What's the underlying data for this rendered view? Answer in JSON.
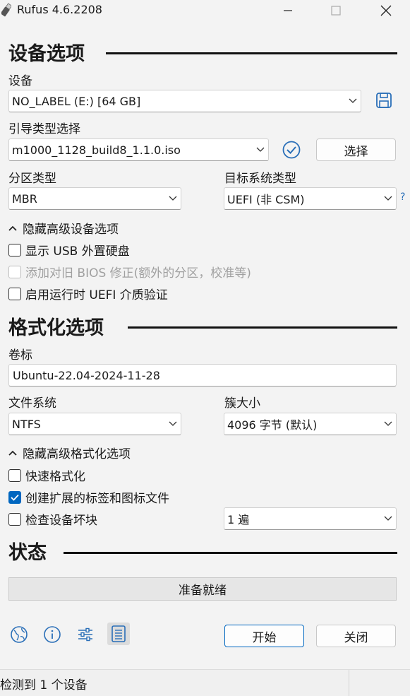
{
  "window": {
    "title": "Rufus 4.6.2208"
  },
  "device_section": {
    "heading": "设备选项",
    "device_label": "设备",
    "device_value": "NO_LABEL (E:) [64 GB]",
    "boot_label": "引导类型选择",
    "boot_value": "m1000_1128_build8_1.1.0.iso",
    "select_button": "选择",
    "partition_label": "分区类型",
    "partition_value": "MBR",
    "target_label": "目标系统类型",
    "target_value": "UEFI (非 CSM)",
    "target_help": "?",
    "advanced_toggle": "隐藏高级设备选项",
    "opt_show_usb": "显示 USB 外置硬盘",
    "opt_bios_fix": "添加对旧 BIOS 修正(额外的分区，校准等)",
    "opt_uefi_verify": "启用运行时 UEFI 介质验证"
  },
  "format_section": {
    "heading": "格式化选项",
    "volume_label": "卷标",
    "volume_value": "Ubuntu-22.04-2024-11-28",
    "fs_label": "文件系统",
    "fs_value": "NTFS",
    "cluster_label": "簇大小",
    "cluster_value": "4096 字节 (默认)",
    "advanced_toggle": "隐藏高级格式化选项",
    "opt_quick": "快速格式化",
    "opt_extended": "创建扩展的标签和图标文件",
    "opt_badblocks": "检查设备坏块",
    "passes_value": "1 遍"
  },
  "status_section": {
    "heading": "状态",
    "status_text": "准备就绪"
  },
  "actions": {
    "start": "开始",
    "close": "关闭"
  },
  "footer": {
    "text": "检测到 1 个设备"
  },
  "colors": {
    "accent": "#0067c0",
    "status_bg": "#e6e6e6"
  }
}
